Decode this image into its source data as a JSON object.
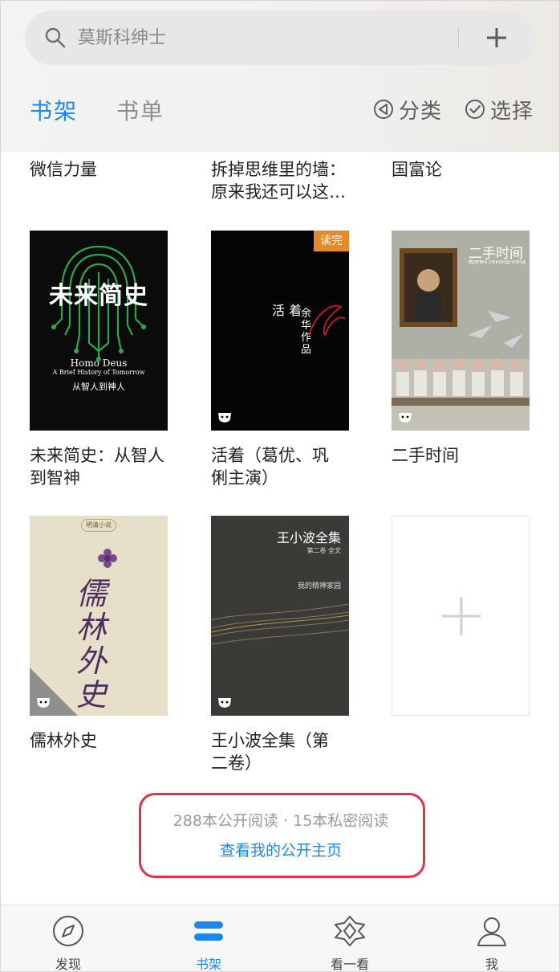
{
  "search": {
    "placeholder": "莫斯科绅士"
  },
  "tabs": {
    "shelf": "书架",
    "list": "书单"
  },
  "actions": {
    "category": "分类",
    "select": "选择"
  },
  "books_row0": [
    {
      "title": "微信力量"
    },
    {
      "title": "拆掉思维里的墙：原来我还可以这…"
    },
    {
      "title": "国富论"
    }
  ],
  "books_row1": [
    {
      "title": "未来简史：从智人到智神",
      "cover_title": "未来简史",
      "cover_en1": "Homo Deus",
      "cover_en2": "A Brief History of Tomorrow",
      "cover_sub": "从智人到神人"
    },
    {
      "title": "活着（葛优、巩俐主演）",
      "cover_title": "活 着",
      "cover_author": "余华作品",
      "badge": "读完"
    },
    {
      "title": "二手时间",
      "cover_title": "二手时间",
      "cover_sub": "Время секонд-хэнд"
    }
  ],
  "books_row2": [
    {
      "title": "儒林外史",
      "cover_tag": "明清小说",
      "cover_title": "儒林外史"
    },
    {
      "title": "王小波全集（第二卷）",
      "cover_title": "王小波全集",
      "cover_sub": "第二卷  全文",
      "cover_sub2": "我的精神家园"
    }
  ],
  "stats": {
    "summary": "288本公开阅读 · 15本私密阅读",
    "link": "查看我的公开主页"
  },
  "tabbar": {
    "discover": "发现",
    "shelf": "书架",
    "look": "看一看",
    "me": "我"
  },
  "colors": {
    "accent": "#1b88ee",
    "highlight": "#e0334b",
    "badge": "#e58a2b"
  }
}
